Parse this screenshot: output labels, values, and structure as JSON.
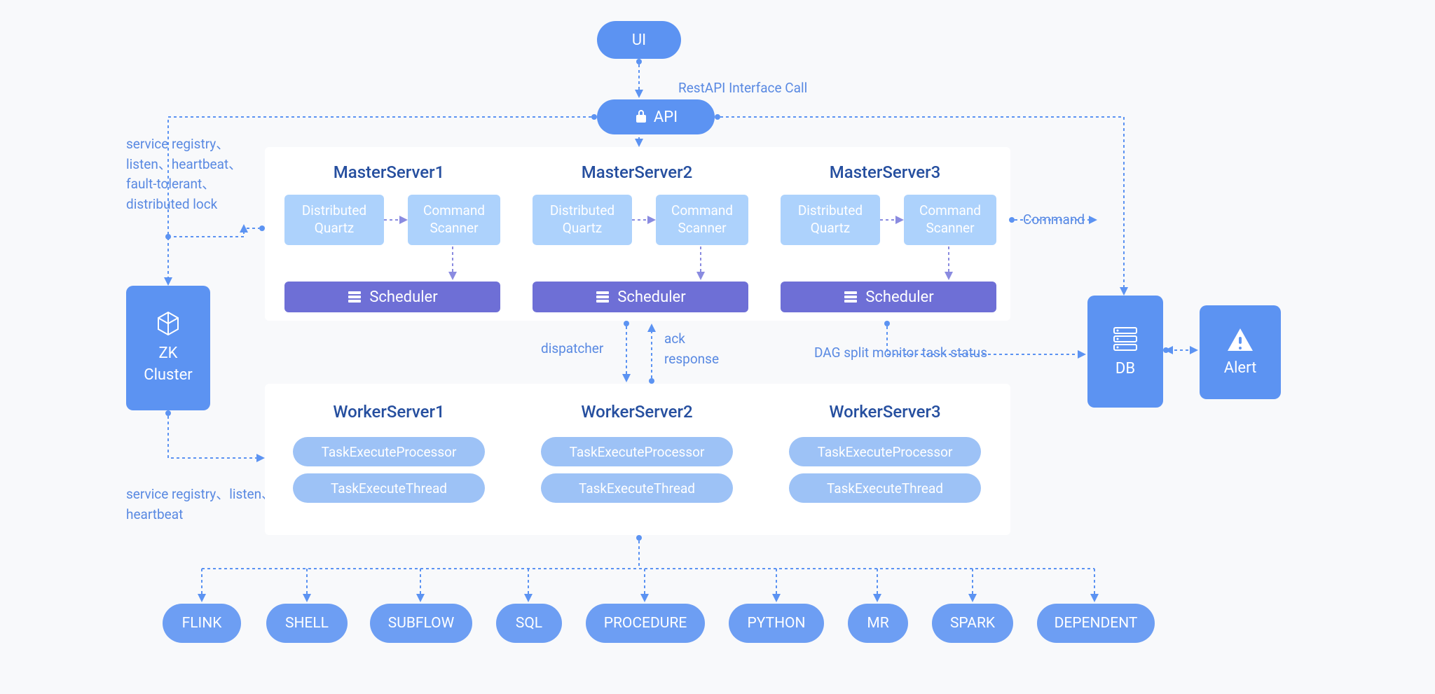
{
  "top": {
    "ui": "UI",
    "api": "API",
    "rest_label": "RestAPI Interface Call"
  },
  "left": {
    "zk_line1": "ZK",
    "zk_line2": "Cluster",
    "note_top": "service registry、listen、heartbeat、fault-tolerant、distributed lock",
    "note_bottom": "service registry、listen、heartbeat"
  },
  "masters": [
    {
      "title": "MasterServer1",
      "dq_l1": "Distributed",
      "dq_l2": "Quartz",
      "cs_l1": "Command",
      "cs_l2": "Scanner",
      "sched": "Scheduler"
    },
    {
      "title": "MasterServer2",
      "dq_l1": "Distributed",
      "dq_l2": "Quartz",
      "cs_l1": "Command",
      "cs_l2": "Scanner",
      "sched": "Scheduler"
    },
    {
      "title": "MasterServer3",
      "dq_l1": "Distributed",
      "dq_l2": "Quartz",
      "cs_l1": "Command",
      "cs_l2": "Scanner",
      "sched": "Scheduler"
    }
  ],
  "middle_labels": {
    "dispatcher": "dispatcher",
    "ack": "ack response",
    "dag": "DAG split monitor task status",
    "command": "Command"
  },
  "workers": [
    {
      "title": "WorkerServer1",
      "p1": "TaskExecuteProcessor",
      "p2": "TaskExecuteThread"
    },
    {
      "title": "WorkerServer2",
      "p1": "TaskExecuteProcessor",
      "p2": "TaskExecuteThread"
    },
    {
      "title": "WorkerServer3",
      "p1": "TaskExecuteProcessor",
      "p2": "TaskExecuteThread"
    }
  ],
  "right": {
    "db": "DB",
    "alert": "Alert"
  },
  "tasks": [
    "FLINK",
    "SHELL",
    "SUBFLOW",
    "SQL",
    "PROCEDURE",
    "PYTHON",
    "MR",
    "SPARK",
    "DEPENDENT"
  ]
}
